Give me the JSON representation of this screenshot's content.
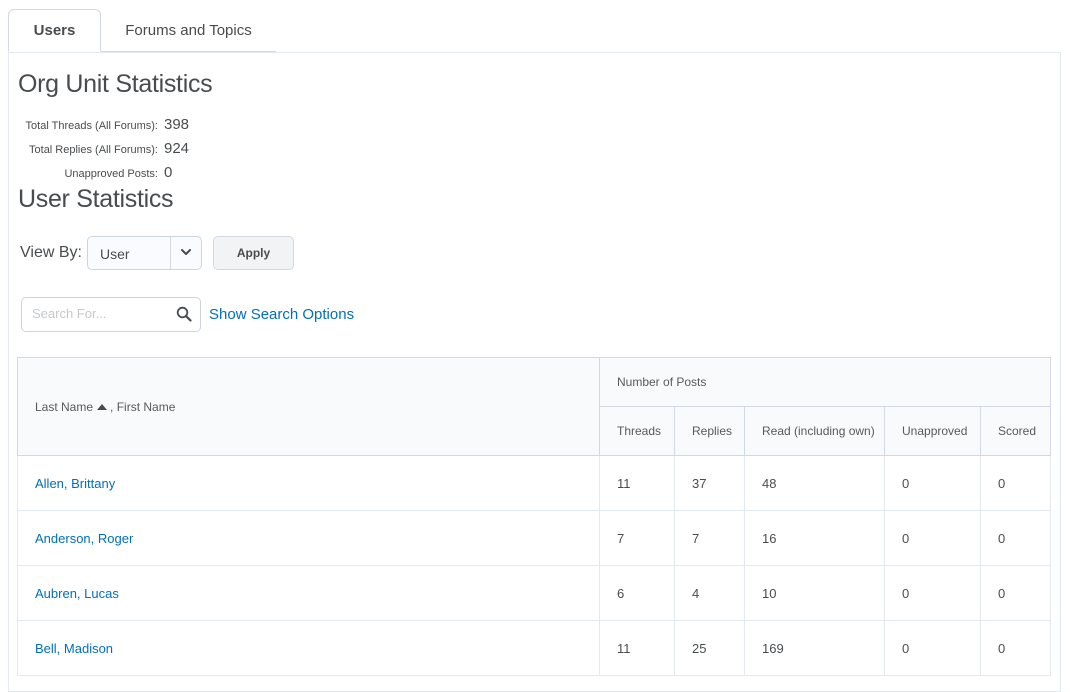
{
  "tabs": [
    {
      "label": "Users",
      "active": true
    },
    {
      "label": "Forums and Topics",
      "active": false
    }
  ],
  "org_stats": {
    "title": "Org Unit Statistics",
    "rows": [
      {
        "label": "Total Threads (All Forums):",
        "value": "398"
      },
      {
        "label": "Total Replies (All Forums):",
        "value": "924"
      },
      {
        "label": "Unapproved Posts:",
        "value": "0"
      }
    ]
  },
  "user_stats": {
    "title": "User Statistics",
    "view_by_label": "View By:",
    "view_by_value": "User",
    "apply_label": "Apply",
    "search_placeholder": "Search For...",
    "show_search_options": "Show Search Options"
  },
  "table": {
    "name_header_last": "Last Name",
    "name_header_first": ", First Name",
    "group_header": "Number of Posts",
    "columns": [
      "Threads",
      "Replies",
      "Read (including own)",
      "Unapproved",
      "Scored"
    ],
    "rows": [
      {
        "name": "Allen, Brittany",
        "threads": "11",
        "replies": "37",
        "read": "48",
        "unapproved": "0",
        "scored": "0"
      },
      {
        "name": "Anderson, Roger",
        "threads": "7",
        "replies": "7",
        "read": "16",
        "unapproved": "0",
        "scored": "0"
      },
      {
        "name": "Aubren, Lucas",
        "threads": "6",
        "replies": "4",
        "read": "10",
        "unapproved": "0",
        "scored": "0"
      },
      {
        "name": "Bell, Madison",
        "threads": "11",
        "replies": "25",
        "read": "169",
        "unapproved": "0",
        "scored": "0"
      }
    ]
  },
  "colors": {
    "link": "#006fbf",
    "text": "#494c4e",
    "border": "#d3d9e3"
  }
}
